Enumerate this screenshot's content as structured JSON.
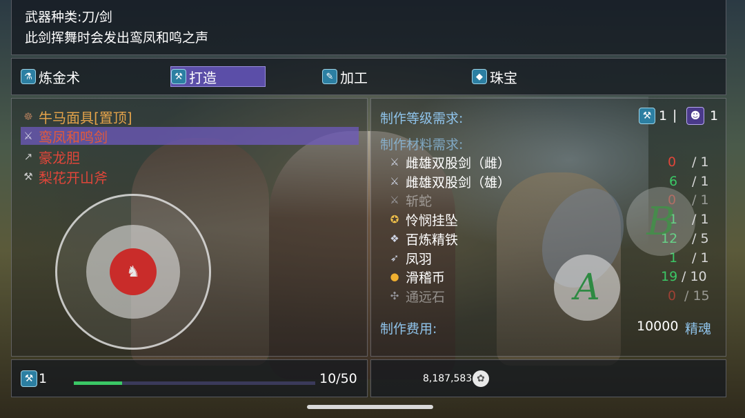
{
  "info": {
    "weapon_type": "武器种类:刀/剑",
    "description": "此剑挥舞时会发出鸾凤和鸣之声"
  },
  "tabs": [
    {
      "label": "炼金术",
      "icon": "flask-icon",
      "active": false
    },
    {
      "label": "打造",
      "icon": "anvil-icon",
      "active": true
    },
    {
      "label": "加工",
      "icon": "wrench-icon",
      "active": false
    },
    {
      "label": "珠宝",
      "icon": "gem-icon",
      "active": false
    }
  ],
  "recipes": [
    {
      "name": "牛马面具[置顶]",
      "icon": "mask-icon",
      "color": "#e3a24a",
      "selected": false
    },
    {
      "name": "鸾凤和鸣剑",
      "icon": "sword-icon",
      "color": "#e25a3b",
      "selected": true
    },
    {
      "name": "豪龙胆",
      "icon": "spear-icon",
      "color": "#e0463a",
      "selected": false
    },
    {
      "name": "梨花开山斧",
      "icon": "axe-icon",
      "color": "#e0463a",
      "selected": false
    }
  ],
  "requirements": {
    "level_label": "制作等级需求:",
    "levels": [
      {
        "icon": "anvil-icon",
        "value": "1"
      },
      {
        "icon": "portrait-icon",
        "value": "1"
      }
    ],
    "separator": "|",
    "materials_label": "制作材料需求:",
    "materials": [
      {
        "name": "雌雄双股剑（雌）",
        "icon": "sword-icon",
        "have": "0",
        "need": "1",
        "have_color": "#e0463a",
        "dim": false
      },
      {
        "name": "雌雄双股剑（雄）",
        "icon": "sword-icon",
        "have": "6",
        "need": "1",
        "have_color": "#3bc866",
        "dim": false
      },
      {
        "name": "斩蛇",
        "icon": "blade-icon",
        "have": "0",
        "need": "1",
        "have_color": "#e0463a",
        "dim": true
      },
      {
        "name": "怜悯挂坠",
        "icon": "pendant-icon",
        "have": "1",
        "need": "1",
        "have_color": "#3bc866",
        "dim": false
      },
      {
        "name": "百炼精铁",
        "icon": "iron-icon",
        "have": "12",
        "need": "5",
        "have_color": "#3bc866",
        "dim": false
      },
      {
        "name": "凤羽",
        "icon": "feather-icon",
        "have": "1",
        "need": "1",
        "have_color": "#3bc866",
        "dim": false
      },
      {
        "name": "滑稽币",
        "icon": "coin-icon",
        "have": "19",
        "need": "10",
        "have_color": "#3bc866",
        "dim": false
      },
      {
        "name": "通远石",
        "icon": "stone-icon",
        "have": "0",
        "need": "15",
        "have_color": "#e0463a",
        "dim": true
      }
    ],
    "cost_label": "制作费用:",
    "cost_value": "10000",
    "cost_unit": "精魂"
  },
  "footer": {
    "level": "1",
    "progress_text": "10/50",
    "progress_fraction": 0.2,
    "currency_amount": "8,187,583",
    "currency_icon": "soul-bag-icon"
  },
  "controls": {
    "joystick_icon": "knight-avatar-icon",
    "button_a": "A",
    "button_b": "B"
  },
  "colors": {
    "accent_label": "#8fc3ea",
    "selected_row": "#6e5abe",
    "active_tab": "#5b4ea8",
    "ok": "#3bc866",
    "missing": "#e0463a"
  }
}
